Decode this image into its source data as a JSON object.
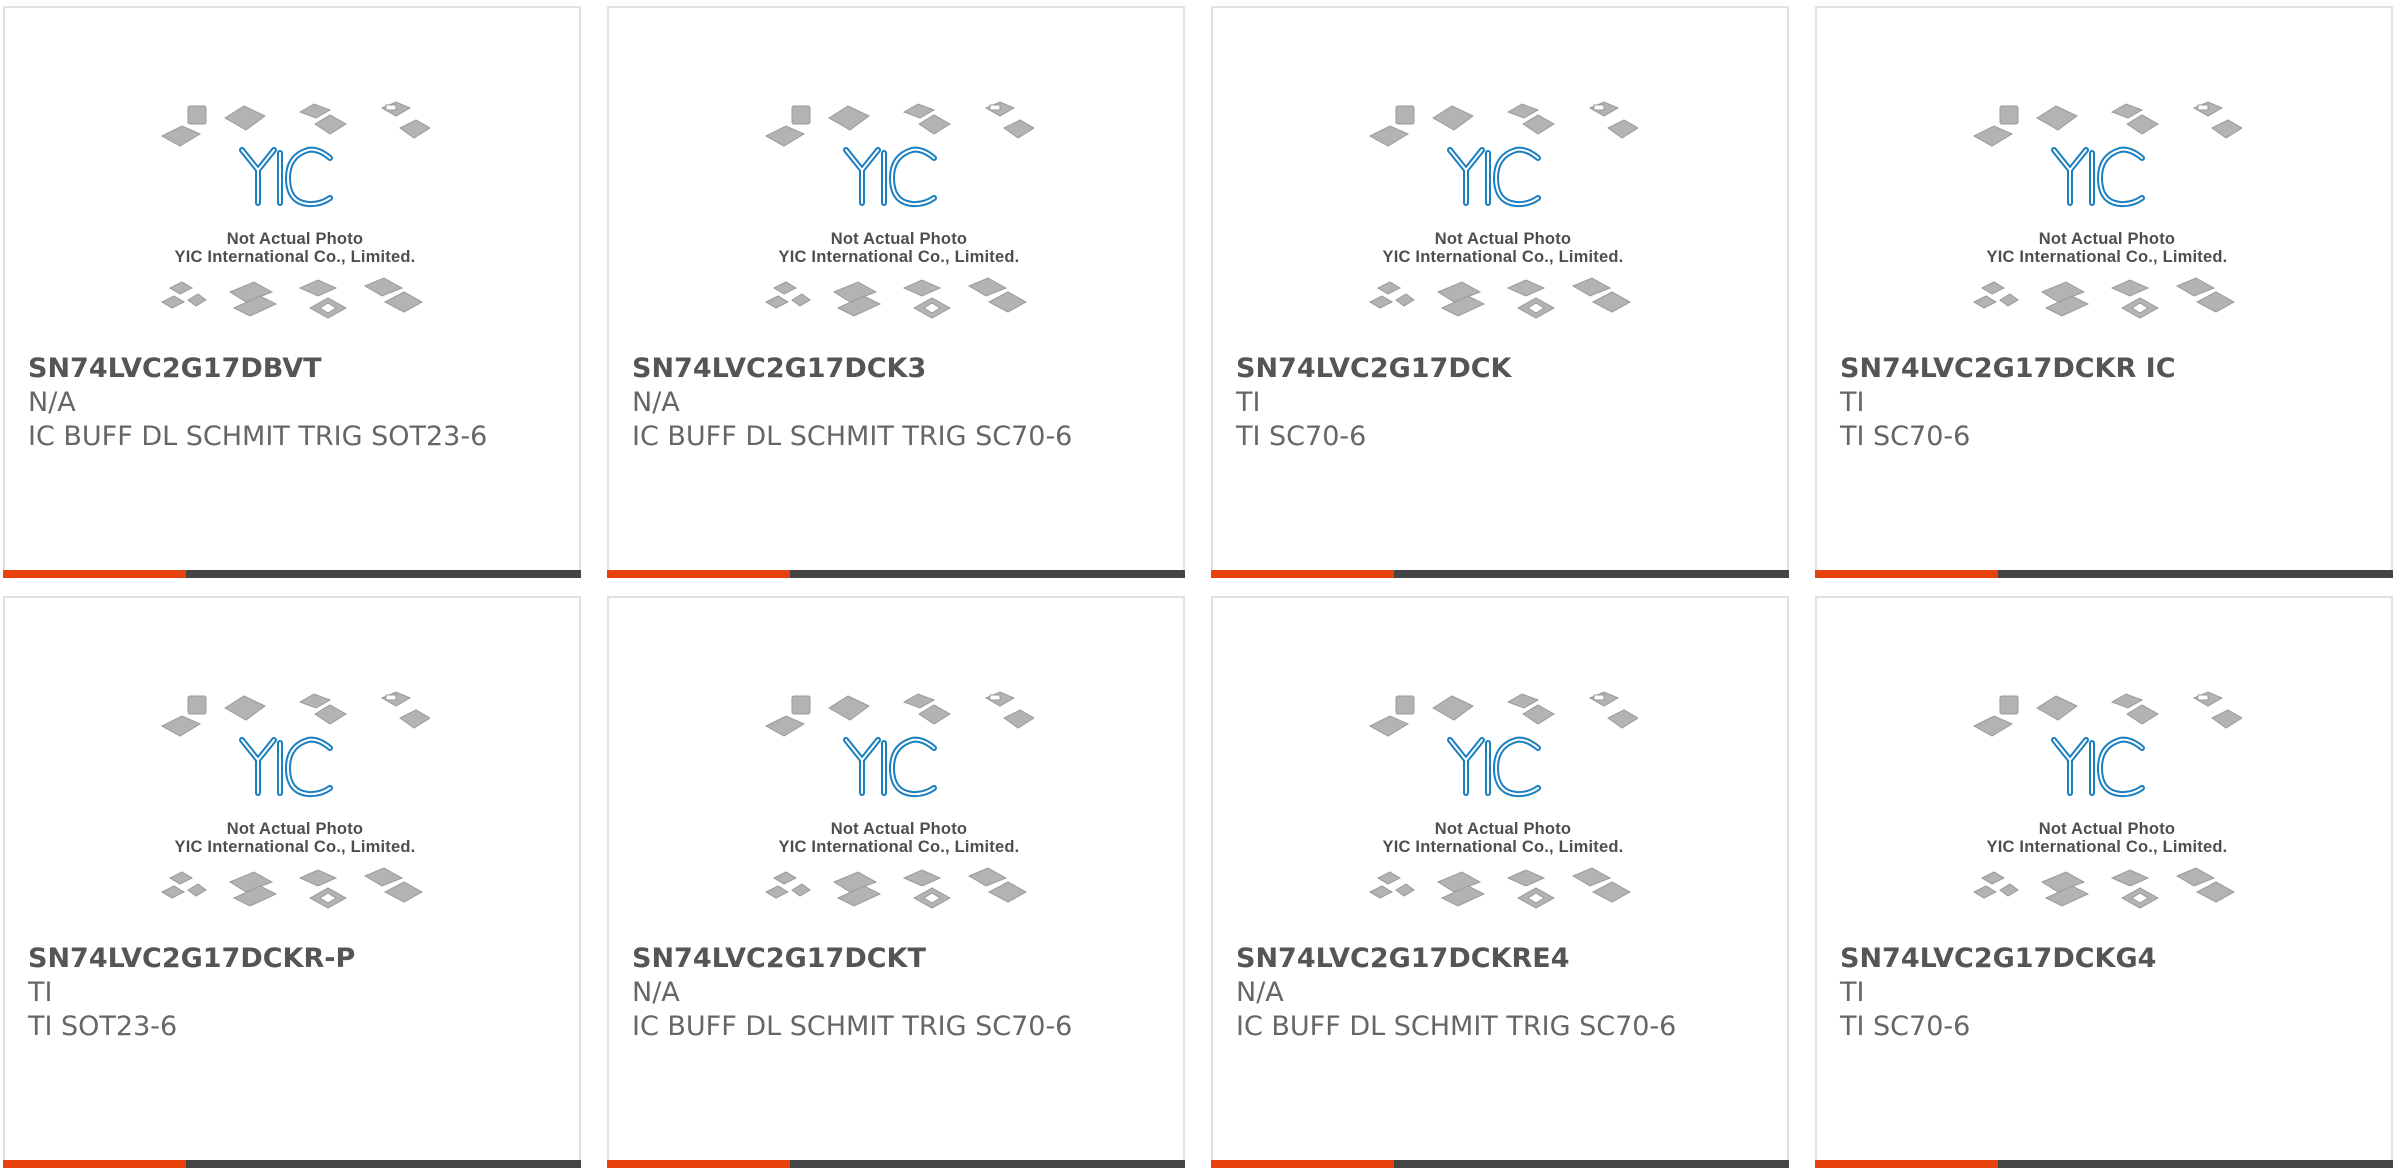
{
  "watermark": {
    "line1": "Not Actual Photo",
    "line2": "YIC International Co., Limited.",
    "logo_text": "YIC",
    "logo_color": "#1a7fc1"
  },
  "colors": {
    "accent": "#e8420f",
    "bar": "#444444",
    "title": "#555555",
    "text": "#666666"
  },
  "products": [
    {
      "part_number": "SN74LVC2G17DBVT",
      "manufacturer": "N/A",
      "description": "IC BUFF DL SCHMIT TRIG SOT23-6"
    },
    {
      "part_number": "SN74LVC2G17DCK3",
      "manufacturer": "N/A",
      "description": "IC BUFF DL SCHMIT TRIG SC70-6"
    },
    {
      "part_number": "SN74LVC2G17DCK",
      "manufacturer": "TI",
      "description": "TI SC70-6"
    },
    {
      "part_number": "SN74LVC2G17DCKR IC",
      "manufacturer": "TI",
      "description": "TI SC70-6"
    },
    {
      "part_number": "SN74LVC2G17DCKR-P",
      "manufacturer": "TI",
      "description": "TI SOT23-6"
    },
    {
      "part_number": "SN74LVC2G17DCKT",
      "manufacturer": "N/A",
      "description": "IC BUFF DL SCHMIT TRIG SC70-6"
    },
    {
      "part_number": "SN74LVC2G17DCKRE4",
      "manufacturer": "N/A",
      "description": "IC BUFF DL SCHMIT TRIG SC70-6"
    },
    {
      "part_number": "SN74LVC2G17DCKG4",
      "manufacturer": "TI",
      "description": "TI SC70-6"
    }
  ]
}
